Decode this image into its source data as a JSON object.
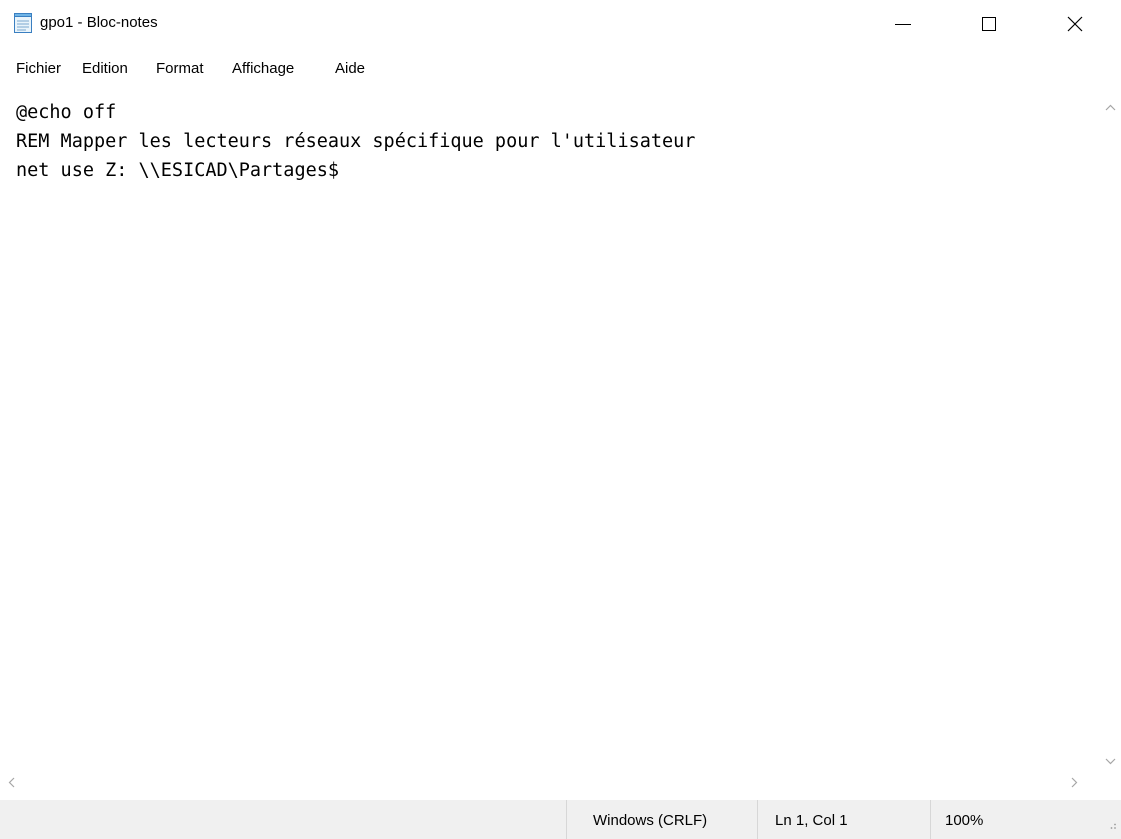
{
  "window": {
    "title": "gpo1 - Bloc-notes",
    "icon": "notepad-icon"
  },
  "menu": {
    "items": [
      "Fichier",
      "Edition",
      "Format",
      "Affichage",
      "Aide"
    ]
  },
  "editor": {
    "lines": [
      "@echo off",
      "REM Mapper les lecteurs réseaux spécifique pour l'utilisateur",
      "net use Z: \\\\ESICAD\\Partages$"
    ]
  },
  "status": {
    "line_ending": "Windows (CRLF)",
    "position": "Ln 1, Col 1",
    "zoom": "100%"
  }
}
